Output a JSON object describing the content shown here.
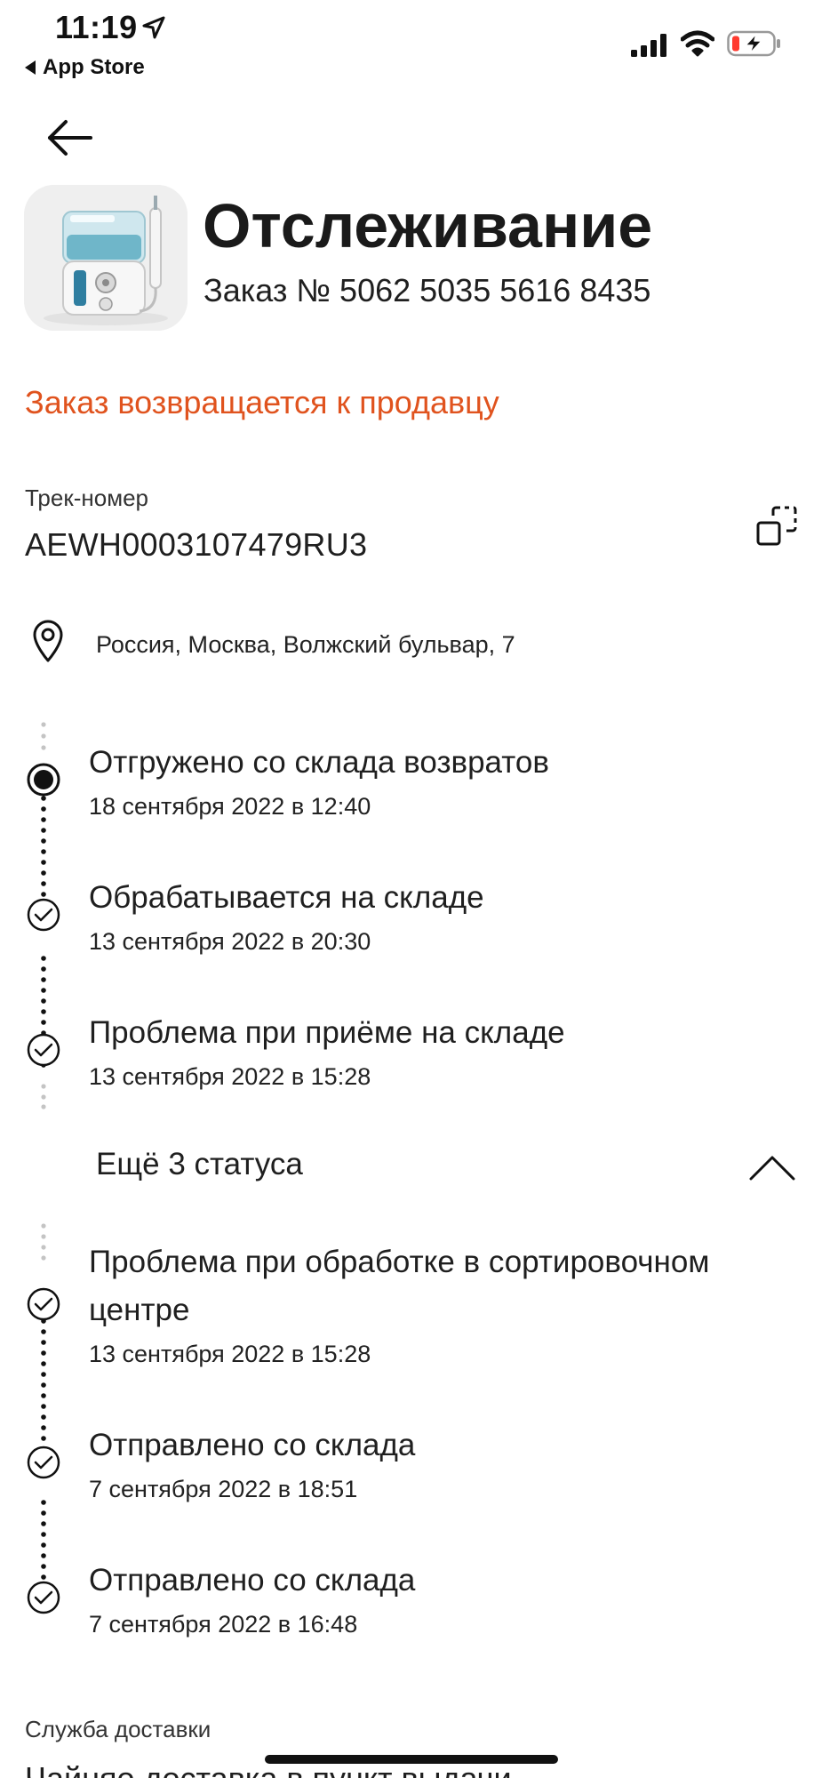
{
  "status_bar": {
    "time": "11:19",
    "back_app": "App Store"
  },
  "header": {
    "title": "Отслеживание",
    "order_number": "Заказ № 5062 5035 5616 8435"
  },
  "order_status": "Заказ возвращается к продавцу",
  "tracking": {
    "label": "Трек-номер",
    "number": "AEWH0003107479RU3"
  },
  "address": "Россия, Москва, Волжский бульвар, 7",
  "timeline_top": [
    {
      "title": "Отгружено со склада возвратов",
      "date": "18 сентября 2022 в 12:40",
      "state": "current"
    },
    {
      "title": "Обрабатывается на складе",
      "date": "13 сентября 2022 в 20:30",
      "state": "done"
    },
    {
      "title": "Проблема при приёме на складе",
      "date": "13 сентября 2022 в 15:28",
      "state": "done"
    }
  ],
  "more_statuses": "Ещё 3 статуса",
  "timeline_bottom": [
    {
      "title": "Проблема при обработке в сортировочном центре",
      "date": "13 сентября 2022 в 15:28",
      "state": "done"
    },
    {
      "title": "Отправлено со склада",
      "date": "7 сентября 2022 в 18:51",
      "state": "done"
    },
    {
      "title": "Отправлено со склада",
      "date": "7 сентября 2022 в 16:48",
      "state": "done"
    }
  ],
  "delivery": {
    "label": "Служба доставки",
    "value": "Чайняо доставка в пункт выдачи"
  },
  "colors": {
    "accent": "#e0531e",
    "text": "#1f1f1f"
  }
}
